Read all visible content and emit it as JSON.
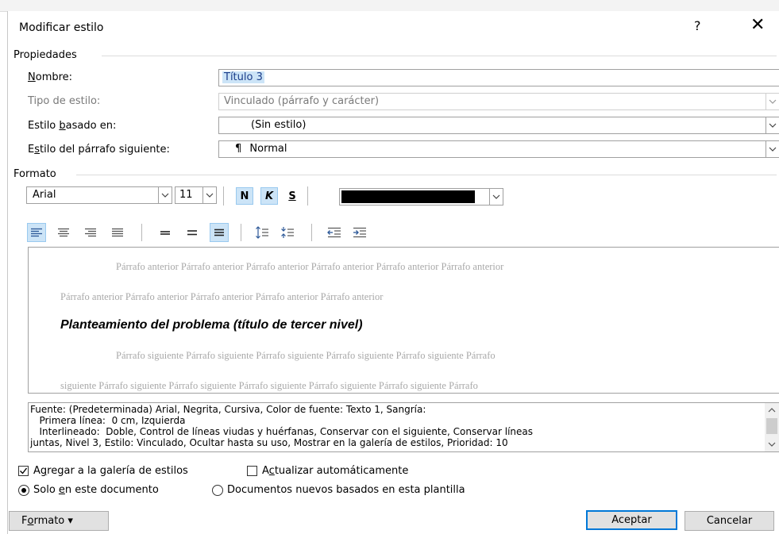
{
  "dialog": {
    "title": "Modificar estilo",
    "help_label": "?",
    "close_label": "✕"
  },
  "properties": {
    "group_label": "Propiedades",
    "name_label_u": "N",
    "name_label_rest": "ombre:",
    "name_value": "Título 3",
    "type_label": "Tipo de estilo:",
    "type_value": "Vinculado (párrafo y carácter)",
    "based_label_pre": "Estilo ",
    "based_label_u": "b",
    "based_label_rest": "asado en:",
    "based_value": "(Sin estilo)",
    "next_label_pre": "E",
    "next_label_u": "s",
    "next_label_rest": "tilo del párrafo siguiente:",
    "next_value_icon": "¶",
    "next_value": "Normal"
  },
  "format": {
    "group_label": "Formato",
    "font_name": "Arial",
    "font_size": "11",
    "bold_label": "N",
    "italic_label": "K",
    "underline_label": "S",
    "font_color": "#000000",
    "bold_active": true,
    "italic_active": true
  },
  "alignment_icons": [
    "align-left-icon",
    "align-center-icon",
    "align-right-icon",
    "justify-icon",
    "single-spacing-icon",
    "one-half-spacing-icon",
    "double-spacing-icon",
    "increase-paragraph-spacing-icon",
    "decrease-paragraph-spacing-icon",
    "decrease-indent-icon",
    "increase-indent-icon"
  ],
  "preview": {
    "prev_line1": "Párrafo anterior Párrafo anterior Párrafo anterior Párrafo anterior Párrafo anterior Párrafo anterior",
    "prev_line2": "Párrafo anterior Párrafo anterior Párrafo anterior Párrafo anterior Párrafo anterior",
    "main_text": "Planteamiento del problema (título de tercer nivel)",
    "next_line1": "Párrafo siguiente Párrafo siguiente Párrafo siguiente Párrafo siguiente Párrafo siguiente Párrafo",
    "next_line2": "siguiente Párrafo siguiente Párrafo siguiente Párrafo siguiente Párrafo siguiente Párrafo siguiente Párrafo"
  },
  "description": {
    "line1": "Fuente: (Predeterminada) Arial, Negrita, Cursiva, Color de fuente: Texto 1, Sangría:",
    "line2": "   Primera línea:  0 cm, Izquierda",
    "line3": "   Interlineado:  Doble, Control de líneas viudas y huérfanas, Conservar con el siguiente, Conservar líneas",
    "line4": "juntas, Nivel 3, Estilo: Vinculado, Ocultar hasta su uso, Mostrar en la galería de estilos, Prioridad: 10"
  },
  "options": {
    "add_gallery_pre": "A",
    "add_gallery_u": "g",
    "add_gallery_rest": "regar a la galería de estilos",
    "add_gallery_checked": true,
    "auto_update_pre": "A",
    "auto_update_u": "c",
    "auto_update_rest": "tualizar automáticamente",
    "auto_update_checked": false,
    "only_doc_pre": "Solo ",
    "only_doc_u": "e",
    "only_doc_rest": "n este documento",
    "only_doc_selected": true,
    "new_docs_label": "Documentos nuevos basados en esta plantilla",
    "new_docs_selected": false
  },
  "buttons": {
    "format_label_pre": "F",
    "format_label_u": "o",
    "format_label_rest": "rmato ▾",
    "ok_label": "Aceptar",
    "cancel_label": "Cancelar"
  },
  "colors": {
    "accent": "#0078d7",
    "selection": "#cce4f7"
  }
}
